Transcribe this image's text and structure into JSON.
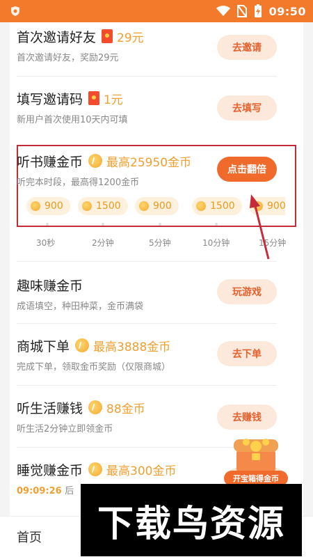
{
  "status_bar": {
    "time": "09:50"
  },
  "tasks": {
    "invite": {
      "title": "首次邀请好友",
      "reward": "29元",
      "desc": "首次邀请好友，奖励29元",
      "button": "去邀请"
    },
    "code": {
      "title": "填写邀请码",
      "reward": "1元",
      "desc": "新用户首次使用10天内可填",
      "button": "去填写"
    },
    "listen": {
      "title": "听书赚金币",
      "reward": "最高25950金币",
      "desc": "听完本时段，最高得1200金币",
      "button": "点击翻倍",
      "pills": [
        "900",
        "1500",
        "900",
        "1500",
        "900"
      ],
      "times": [
        "30秒",
        "2分钟",
        "5分钟",
        "10分钟",
        "15分钟"
      ]
    },
    "fun": {
      "title": "趣味赚金币",
      "desc": "成语填空，种田种菜，金币满袋",
      "button": "玩游戏"
    },
    "mall": {
      "title": "商城下单",
      "reward": "最高3888金币",
      "desc": "完成下单，领取金币奖励（仅限商城）",
      "button": "去下单"
    },
    "life": {
      "title": "听生活赚钱",
      "reward": "88金币",
      "desc": "听生活2分钟立即领金币",
      "button": "去赚钱"
    },
    "sleep": {
      "title": "睡觉赚金币",
      "reward": "最高300金币",
      "countdown": "09:09:26",
      "desc_suffix": "后"
    }
  },
  "treasure": {
    "label": "开宝箱得金币"
  },
  "bottom_nav": {
    "home": "首页"
  },
  "watermark": {
    "text": "下载鸟资源"
  },
  "colors": {
    "accent": "#f06a2c",
    "status_bar": "#f27a2a",
    "reward": "#f0a030",
    "highlight_box": "#c62b3a"
  }
}
